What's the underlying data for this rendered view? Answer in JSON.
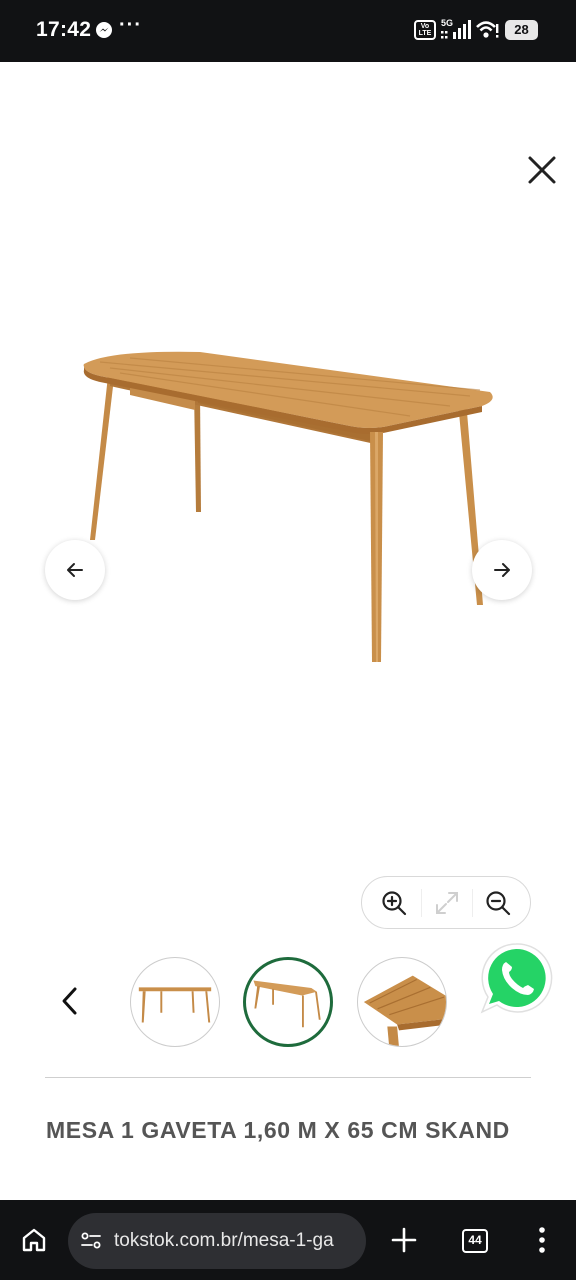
{
  "status_bar": {
    "time": "17:42",
    "more_indicator": "···",
    "volte_label": "Vo LTE",
    "network_label": "5G",
    "battery_level": "28",
    "icons": [
      "messenger-icon",
      "volte-icon",
      "signal-icon",
      "wifi-icon",
      "battery-icon"
    ]
  },
  "gallery": {
    "close_icon": "close-icon",
    "prev_icon": "arrow-left-icon",
    "next_icon": "arrow-right-icon",
    "zoom_controls": [
      "zoom-in-icon",
      "expand-icon",
      "zoom-out-icon"
    ],
    "thumbnails": [
      {
        "name": "thumbnail-front",
        "active": false
      },
      {
        "name": "thumbnail-angle",
        "active": true
      },
      {
        "name": "thumbnail-detail",
        "active": false
      }
    ],
    "thumb_prev_icon": "chevron-left-icon"
  },
  "whatsapp_icon": "whatsapp-icon",
  "product": {
    "title": "MESA 1 GAVETA 1,60 M X 65 CM SKAND"
  },
  "browser": {
    "url": "tokstok.com.br/mesa-1-ga",
    "tab_count": "44",
    "icons": [
      "home-icon",
      "site-settings-icon",
      "plus-icon",
      "tabs-icon",
      "more-vert-icon"
    ]
  },
  "colors": {
    "status_bar_bg": "#111214",
    "active_thumb_border": "#1e6b3c",
    "title_text": "#555555",
    "whatsapp_green": "#25d366",
    "wood": "#c98f4a"
  }
}
